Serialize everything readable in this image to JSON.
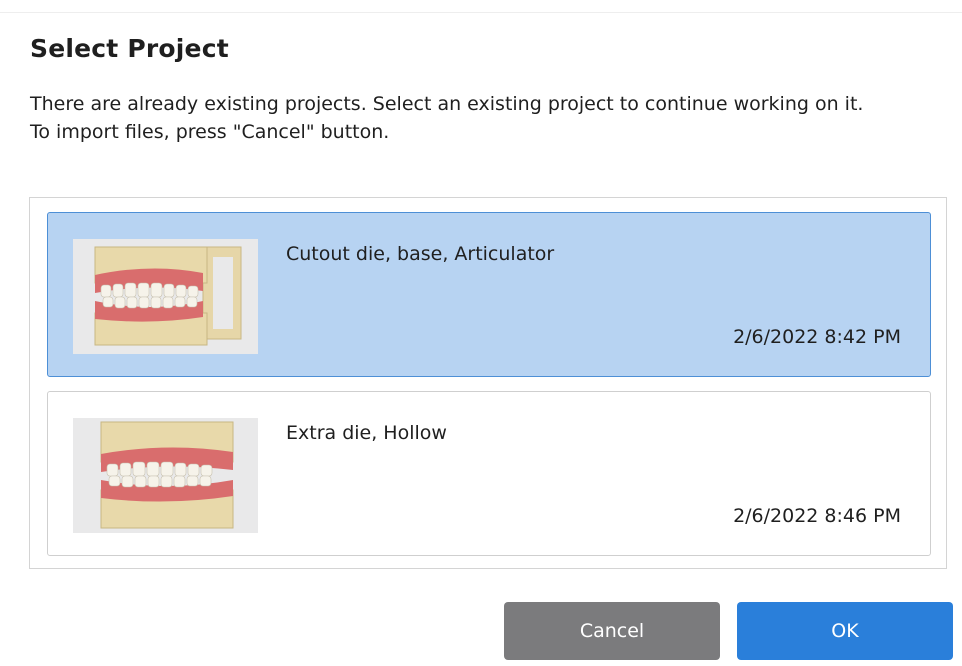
{
  "dialog": {
    "title": "Select Project",
    "description_line1": "There are already existing projects. Select an existing project to continue working on it.",
    "description_line2": "To import files, press \"Cancel\" button."
  },
  "projects": [
    {
      "name": "Cutout die, base, Articulator",
      "date": "2/6/2022 8:42 PM",
      "selected": true,
      "thumbnail_icon": "dental-model-articulator-thumbnail"
    },
    {
      "name": "Extra die, Hollow",
      "date": "2/6/2022 8:46 PM",
      "selected": false,
      "thumbnail_icon": "dental-model-hollow-thumbnail"
    }
  ],
  "buttons": {
    "cancel_label": "Cancel",
    "ok_label": "OK"
  },
  "colors": {
    "selected_background": "#b7d3f2",
    "selected_border": "#4d8fd6",
    "cancel_button": "#7b7b7d",
    "ok_button": "#2a7fda"
  }
}
